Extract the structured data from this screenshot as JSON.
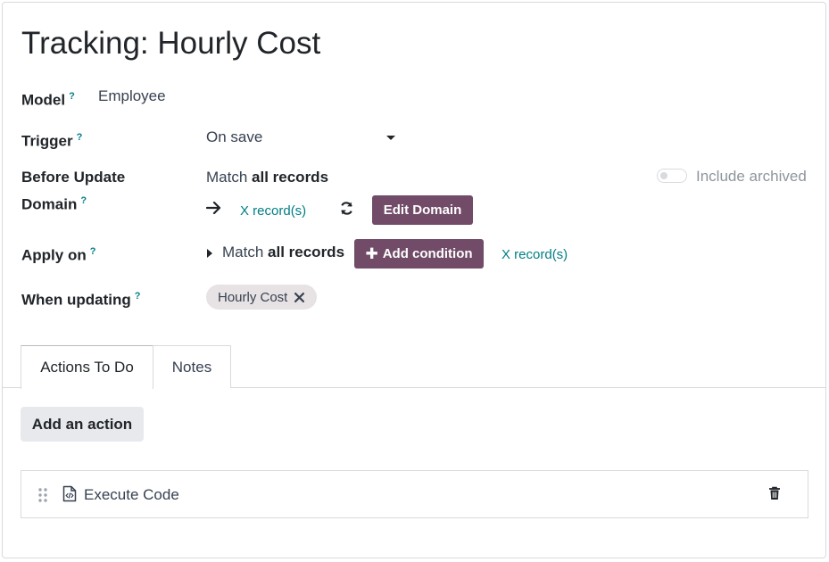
{
  "page": {
    "title": "Tracking: Hourly Cost"
  },
  "fields": {
    "model": {
      "label": "Model",
      "help": "?",
      "value": "Employee"
    },
    "trigger": {
      "label": "Trigger",
      "help": "?",
      "value": "On save"
    },
    "before_update_domain": {
      "label_line1": "Before Update",
      "label_line2": "Domain",
      "help": "?",
      "match_prefix": "Match ",
      "match_bold": "all records",
      "records_link": "X record(s)",
      "edit_button": "Edit Domain",
      "include_archived_label": "Include archived",
      "include_archived_on": false
    },
    "apply_on": {
      "label": "Apply on",
      "help": "?",
      "match_prefix": "Match ",
      "match_bold": "all records",
      "add_condition_button": "Add condition",
      "records_link": "X record(s)"
    },
    "when_updating": {
      "label": "When updating",
      "help": "?",
      "tag": "Hourly Cost"
    }
  },
  "tabs": [
    {
      "label": "Actions To Do",
      "active": true
    },
    {
      "label": "Notes",
      "active": false
    }
  ],
  "actions": {
    "add_button": "Add an action",
    "items": [
      {
        "label": "Execute Code"
      }
    ]
  },
  "colors": {
    "primary": "#714b67",
    "link": "#017e84",
    "tag_bg": "#e7e2e4",
    "secondary_btn_bg": "#e7e9ed"
  }
}
